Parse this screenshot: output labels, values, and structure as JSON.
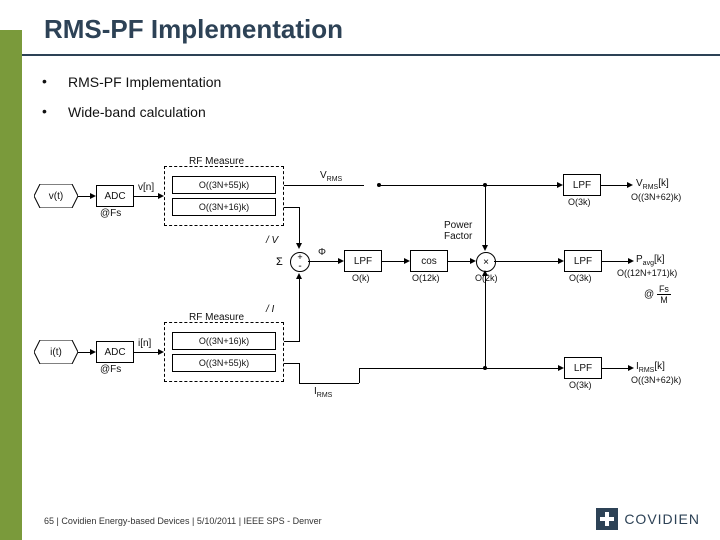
{
  "title": "RMS-PF Implementation",
  "bullets": [
    "RMS-PF Implementation",
    "Wide-band calculation"
  ],
  "footer": {
    "page": "65",
    "sep": "  |  ",
    "org": "Covidien Energy-based Devices",
    "date": "5/10/2011",
    "venue": "IEEE SPS - Denver"
  },
  "brand": "COVIDIEN",
  "labels": {
    "vt": "v(t)",
    "it": "i(t)",
    "adc": "ADC",
    "fs": "@Fs",
    "vn": "v[n]",
    "in": "i[n]",
    "rfm": "RF Measure",
    "o55": "O((3N+55)k)",
    "o16": "O((3N+16)k)",
    "vrms": "V",
    "vrms_sub": "RMS",
    "slashV": "/ V",
    "slashI": "/ I",
    "plus": "+",
    "minus": "-",
    "sum": "Σ",
    "phi": "Φ",
    "lpf": "LPF",
    "ok": "O(k)",
    "cos": "cos",
    "o12k": "O(12k)",
    "mult": "×",
    "o2k": "O(2k)",
    "o3k": "O(3k)",
    "o12n171": "O((12N+171)k)",
    "o3n62": "O((3N+62)k)",
    "pf": "Power\nFactor",
    "Vrmsk": "V",
    "Vrmsk2": "[k]",
    "Vrmsk_sub": "RMS",
    "Pavgk": "P",
    "Pavgk_sub": "avg",
    "Pavgk2": "[k]",
    "Irmsk": "I",
    "Irmsk_sub": "RMS",
    "Irmsk2": "[k]",
    "Irms": "I",
    "Irms_sub": "RMS",
    "clock": "Fs",
    "clockM": "M",
    "at": "@"
  }
}
